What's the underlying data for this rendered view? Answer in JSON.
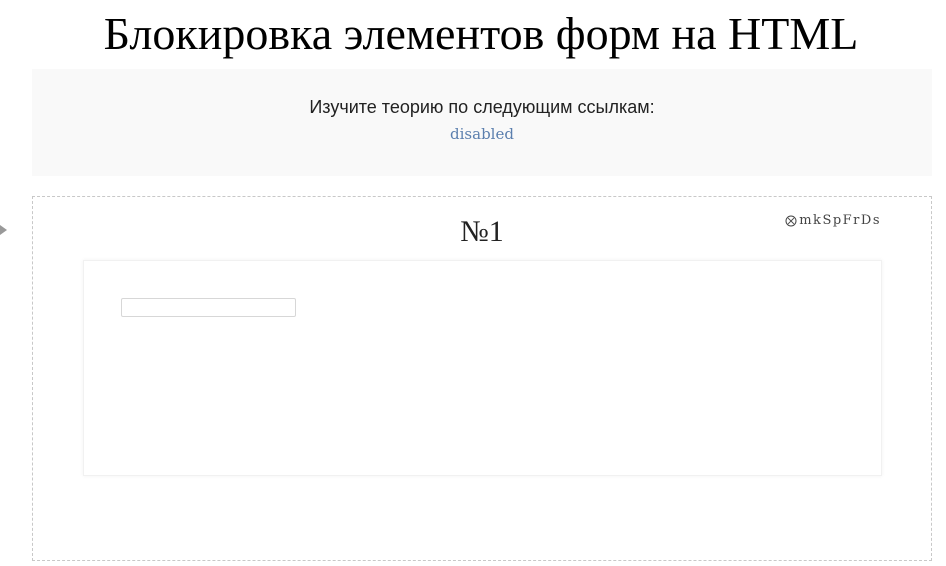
{
  "page": {
    "title": "Блокировка элементов форм на HTML"
  },
  "theory": {
    "intro": "Изучите теорию по следующим ссылкам:",
    "link_label": "disabled"
  },
  "task": {
    "number": "№1",
    "code": "mkSpFrDs",
    "code_icon": "circled-x-icon",
    "input_value": ""
  },
  "colors": {
    "link": "#5b7fae",
    "theory_bg": "#f9f9f9",
    "dashed_border": "#c8c8c8"
  }
}
